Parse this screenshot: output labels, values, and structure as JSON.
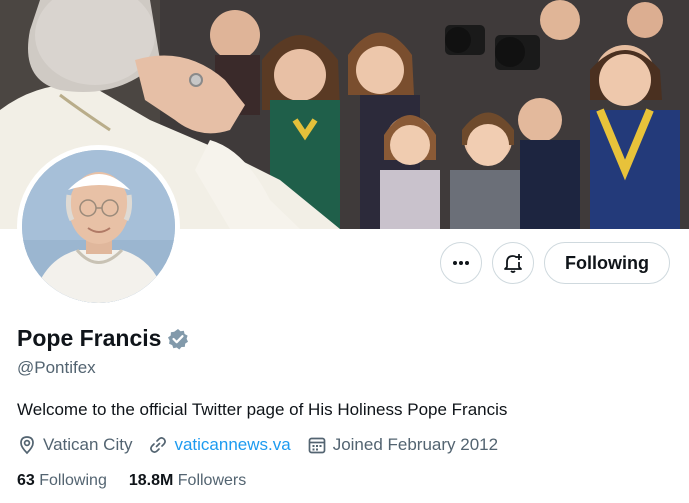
{
  "profile": {
    "display_name": "Pope Francis",
    "verified_icon": "verified-badge-icon",
    "handle": "@Pontifex",
    "bio": "Welcome to the official Twitter page of His Holiness Pope Francis",
    "location": "Vatican City",
    "website": "vaticannews.va",
    "joined": "Joined February 2012",
    "following_count": "63",
    "following_label": "Following",
    "followers_count": "18.8M",
    "followers_label": "Followers"
  },
  "actions": {
    "more_icon": "more-icon",
    "notify_icon": "bell-plus-icon",
    "follow_label": "Following"
  },
  "colors": {
    "link": "#1d9bf0",
    "secondary_text": "#536471",
    "border": "#cfd9de",
    "verified_badge": "#829aab"
  }
}
